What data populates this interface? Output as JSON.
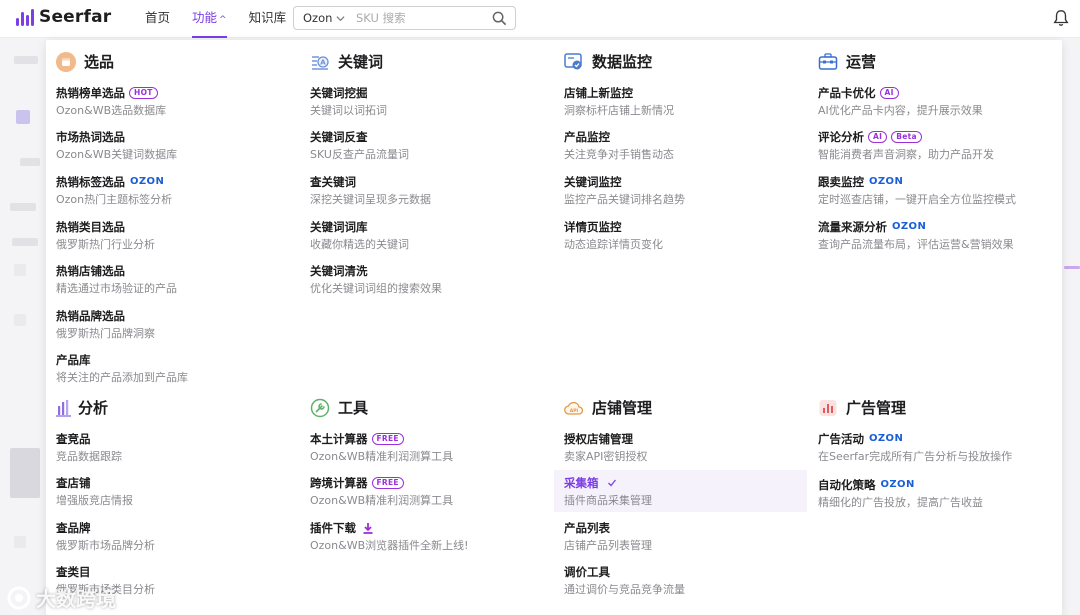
{
  "header": {
    "logo_text": "Seerfar",
    "nav": [
      "首页",
      "功能",
      "知识库"
    ],
    "nav_caret": "^",
    "search_select": "Ozon",
    "search_placeholder": "SKU 搜索"
  },
  "icons": {
    "bell": "bell-icon",
    "search": "search-icon"
  },
  "colors": {
    "accent": "#7b3fe4",
    "badge": "#9b30d9",
    "ozon": "#1a5fd6"
  },
  "sections": {
    "xuanpin": {
      "title": "选品",
      "items": [
        {
          "title": "热销榜单选品",
          "badge": "HOT",
          "desc": "Ozon&WB选品数据库"
        },
        {
          "title": "市场热词选品",
          "desc": "Ozon&WB关键词数据库"
        },
        {
          "title": "热销标签选品",
          "ozon": "OZON",
          "desc": "Ozon热门主题标签分析"
        },
        {
          "title": "热销类目选品",
          "desc": "俄罗斯热门行业分析"
        },
        {
          "title": "热销店铺选品",
          "desc": "精选通过市场验证的产品"
        },
        {
          "title": "热销品牌选品",
          "desc": "俄罗斯热门品牌洞察"
        },
        {
          "title": "产品库",
          "desc": "将关注的产品添加到产品库"
        }
      ]
    },
    "keyword": {
      "title": "关键词",
      "items": [
        {
          "title": "关键词挖掘",
          "desc": "关键词以词拓词"
        },
        {
          "title": "关键词反查",
          "desc": "SKU反查产品流量词"
        },
        {
          "title": "查关键词",
          "desc": "深挖关键词呈现多元数据"
        },
        {
          "title": "关键词词库",
          "desc": "收藏你精选的关键词"
        },
        {
          "title": "关键词清洗",
          "desc": "优化关键词词组的搜索效果"
        }
      ]
    },
    "monitor": {
      "title": "数据监控",
      "items": [
        {
          "title": "店铺上新监控",
          "desc": "洞察标杆店铺上新情况"
        },
        {
          "title": "产品监控",
          "desc": "关注竞争对手销售动态"
        },
        {
          "title": "关键词监控",
          "desc": "监控产品关键词排名趋势"
        },
        {
          "title": "详情页监控",
          "desc": "动态追踪详情页变化"
        }
      ]
    },
    "ops": {
      "title": "运营",
      "items": [
        {
          "title": "产品卡优化",
          "badge": "AI",
          "desc": "AI优化产品卡内容，提升展示效果"
        },
        {
          "title": "评论分析",
          "badge": "AI",
          "badge2": "Beta",
          "desc": "智能消费者声音洞察，助力产品开发"
        },
        {
          "title": "跟卖监控",
          "ozon": "OZON",
          "desc": "定时巡查店铺，一键开启全方位监控模式"
        },
        {
          "title": "流量来源分析",
          "ozon": "OZON",
          "desc": "查询产品流量布局，评估运营&营销效果"
        }
      ]
    },
    "analysis": {
      "title": "分析",
      "items": [
        {
          "title": "查竞品",
          "desc": "竞品数据跟踪"
        },
        {
          "title": "查店铺",
          "desc": "增强版竞店情报"
        },
        {
          "title": "查品牌",
          "desc": "俄罗斯市场品牌分析"
        },
        {
          "title": "查类目",
          "desc": "俄罗斯市场类目分析"
        }
      ]
    },
    "tools": {
      "title": "工具",
      "items": [
        {
          "title": "本土计算器",
          "badge": "FREE",
          "desc": "Ozon&WB精准利润测算工具"
        },
        {
          "title": "跨境计算器",
          "badge": "FREE",
          "desc": "Ozon&WB精准利润测算工具"
        },
        {
          "title": "插件下载",
          "desc": "Ozon&WB浏览器插件全新上线!"
        }
      ]
    },
    "store": {
      "title": "店铺管理",
      "items": [
        {
          "title": "授权店铺管理",
          "desc": "卖家API密钥授权"
        },
        {
          "title": "采集箱",
          "desc": "插件商品采集管理"
        },
        {
          "title": "产品列表",
          "desc": "店铺产品列表管理"
        },
        {
          "title": "调价工具",
          "desc": "通过调价与竞品竞争流量"
        }
      ]
    },
    "ads": {
      "title": "广告管理",
      "items": [
        {
          "title": "广告活动",
          "ozon": "OZON",
          "desc": "在Seerfar完成所有广告分析与投放操作"
        },
        {
          "title": "自动化策略",
          "ozon": "OZON",
          "desc": "精细化的广告投放，提高广告收益"
        }
      ]
    }
  },
  "watermark": "大数跨境"
}
